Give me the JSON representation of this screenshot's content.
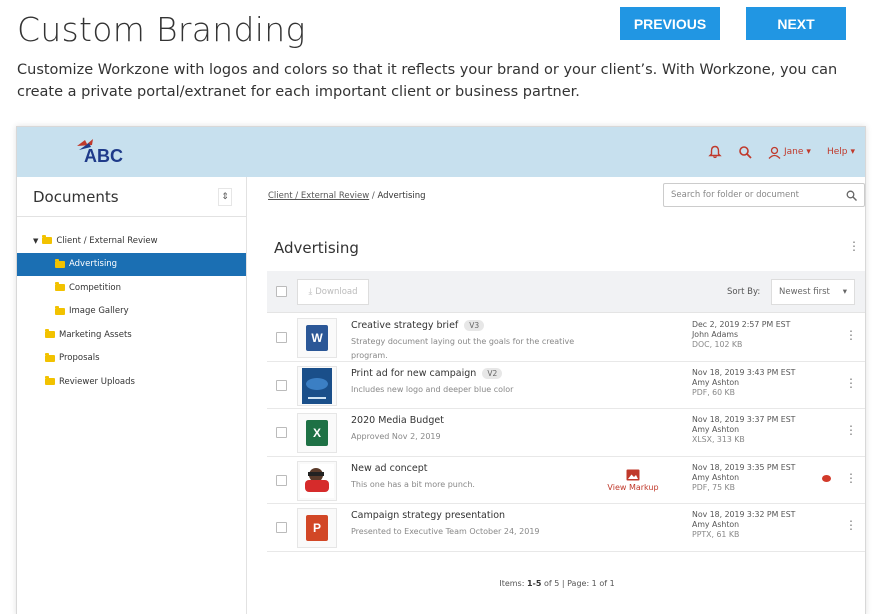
{
  "header": {
    "title": "Custom Branding",
    "previous_label": "PREVIOUS",
    "next_label": "NEXT",
    "description": "Customize Workzone with logos and colors so that it reflects your brand or your client’s. With Workzone, you can create a private portal/extranet for each important client or business partner."
  },
  "app": {
    "logo_text": "ABC",
    "user_label": "Jane",
    "help_label": "Help",
    "sidebar": {
      "title": "Documents",
      "items": [
        {
          "label": "Client / External Review"
        },
        {
          "label": "Advertising"
        },
        {
          "label": "Competition"
        },
        {
          "label": "Image Gallery"
        },
        {
          "label": "Marketing Assets"
        },
        {
          "label": "Proposals"
        },
        {
          "label": "Reviewer Uploads"
        }
      ]
    },
    "breadcrumb": {
      "parent": "Client / External Review",
      "separator": "/",
      "current": "Advertising"
    },
    "search_placeholder": "Search for folder or document",
    "folder_title": "Advertising",
    "toolbar": {
      "download_label": "Download",
      "sort_label": "Sort By:",
      "sort_value": "Newest first"
    },
    "files": [
      {
        "name": "Creative strategy brief",
        "version": "V3",
        "description": "Strategy document laying out the goals for the creative program.",
        "date": "Dec 2, 2019 2:57 PM EST",
        "author": "John Adams",
        "info": "DOC, 102 KB",
        "icon": "word-icon",
        "letter": "W",
        "color": "#2b5797"
      },
      {
        "name": "Print ad for new campaign",
        "version": "V2",
        "description": "Includes new logo and deeper blue color",
        "date": "Nov 18, 2019 3:43 PM EST",
        "author": "Amy Ashton",
        "info": "PDF, 60 KB",
        "icon": "image-thumbnail",
        "letter": "",
        "color": "#1a4f8a"
      },
      {
        "name": "2020 Media Budget",
        "version": "",
        "description": "Approved Nov 2, 2019",
        "date": "Nov 18, 2019 3:37 PM EST",
        "author": "Amy Ashton",
        "info": "XLSX, 313 KB",
        "icon": "excel-icon",
        "letter": "X",
        "color": "#1e7145"
      },
      {
        "name": "New ad concept",
        "version": "",
        "description": "This one has a bit more punch.",
        "date": "Nov 18, 2019 3:35 PM EST",
        "author": "Amy Ashton",
        "info": "PDF, 75 KB",
        "icon": "image-thumbnail",
        "letter": "",
        "color": "#c0392b",
        "markup_label": "View Markup"
      },
      {
        "name": "Campaign strategy presentation",
        "version": "",
        "description": "Presented to Executive Team October 24, 2019",
        "date": "Nov 18, 2019 3:32 PM EST",
        "author": "Amy Ashton",
        "info": "PPTX, 61 KB",
        "icon": "powerpoint-icon",
        "letter": "P",
        "color": "#d24726"
      }
    ],
    "pager": {
      "items_prefix": "Items:",
      "items_range": "1-5",
      "items_suffix": "of 5 | Page: 1 of 1"
    }
  },
  "colors": {
    "accent": "#2196e3",
    "topbar": "#c7e0ee",
    "selected": "#1b6fb3",
    "alert": "#c0392b"
  }
}
